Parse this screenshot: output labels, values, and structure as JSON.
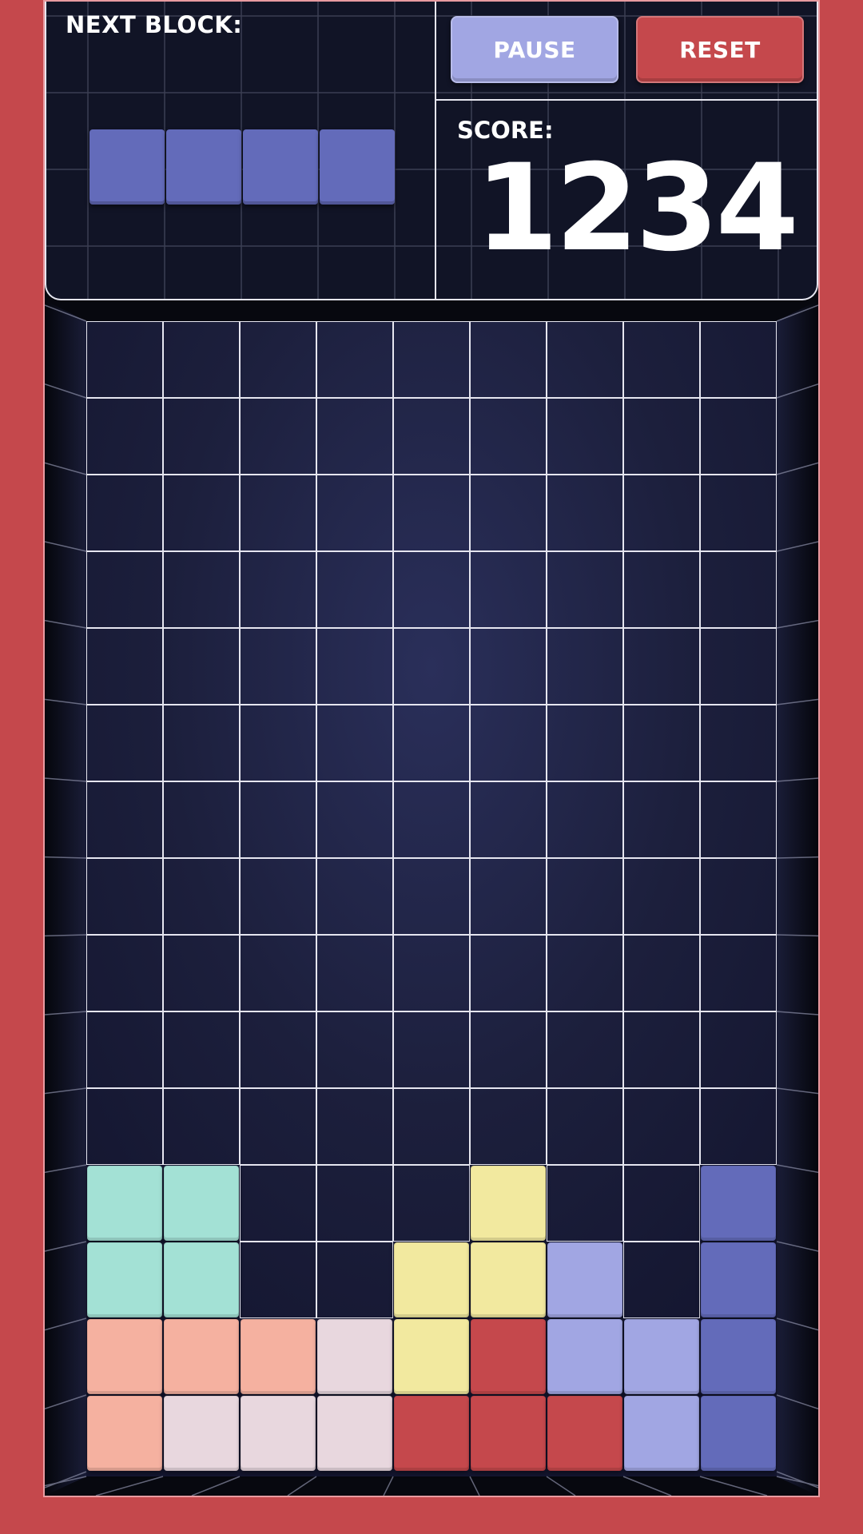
{
  "next_block": {
    "label": "NEXT BLOCK:",
    "piece": "I-piece",
    "color": "#636bba",
    "cells": 4
  },
  "controls": {
    "pause_label": "PAUSE",
    "reset_label": "RESET"
  },
  "score": {
    "label": "SCORE:",
    "value": "1234"
  },
  "colors": {
    "frame": "#c5484c",
    "board_bg": "#1e2140",
    "grid_line": "#e6e6f0",
    "mint": "#a3e1d5",
    "yellow": "#f2e99f",
    "indigo": "#636bba",
    "periwinkle": "#a1a6e3",
    "peach": "#f5b1a0",
    "pale_pink": "#e8d7de",
    "red": "#c5484c"
  },
  "board": {
    "columns": 9,
    "rows": 15,
    "filled_rows": [
      [
        "mint",
        "mint",
        null,
        null,
        null,
        "yellow",
        null,
        null,
        "indigo"
      ],
      [
        "mint",
        "mint",
        null,
        null,
        "yellow",
        "yellow",
        "periwinkle",
        null,
        "indigo"
      ],
      [
        "peach",
        "peach",
        "peach",
        "pale_pink",
        "yellow",
        "red",
        "periwinkle",
        "periwinkle",
        "indigo"
      ],
      [
        "peach",
        "pale_pink",
        "pale_pink",
        "pale_pink",
        "red",
        "red",
        "red",
        "periwinkle",
        "indigo"
      ]
    ]
  }
}
